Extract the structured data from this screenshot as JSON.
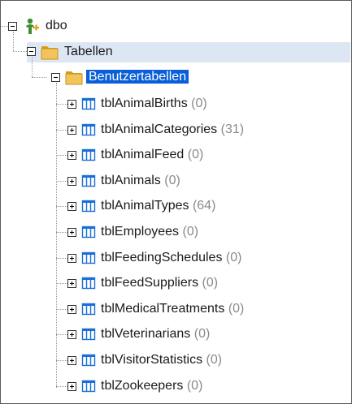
{
  "tree": {
    "root": {
      "label": "dbo",
      "icon": "schema-user-icon"
    },
    "folder": {
      "label": "Tabellen",
      "icon": "folder-open-icon"
    },
    "subfolder": {
      "label": "Benutzertabellen",
      "icon": "folder-open-icon"
    },
    "tables": [
      {
        "name": "tblAnimalBirths",
        "count": "(0)"
      },
      {
        "name": "tblAnimalCategories",
        "count": "(31)"
      },
      {
        "name": "tblAnimalFeed",
        "count": "(0)"
      },
      {
        "name": "tblAnimals",
        "count": "(0)"
      },
      {
        "name": "tblAnimalTypes",
        "count": "(64)"
      },
      {
        "name": "tblEmployees",
        "count": "(0)"
      },
      {
        "name": "tblFeedingSchedules",
        "count": "(0)"
      },
      {
        "name": "tblFeedSuppliers",
        "count": "(0)"
      },
      {
        "name": "tblMedicalTreatments",
        "count": "(0)"
      },
      {
        "name": "tblVeterinarians",
        "count": "(0)"
      },
      {
        "name": "tblVisitorStatistics",
        "count": "(0)"
      },
      {
        "name": "tblZookeepers",
        "count": "(0)"
      }
    ],
    "table_icon": "table-grid-icon"
  },
  "colors": {
    "selection": "#0a5fd8",
    "row_highlight": "#dde7f4",
    "table_icon": "#1a6fd6",
    "folder": "#f2c55c",
    "count_text": "#8a8a8a"
  }
}
